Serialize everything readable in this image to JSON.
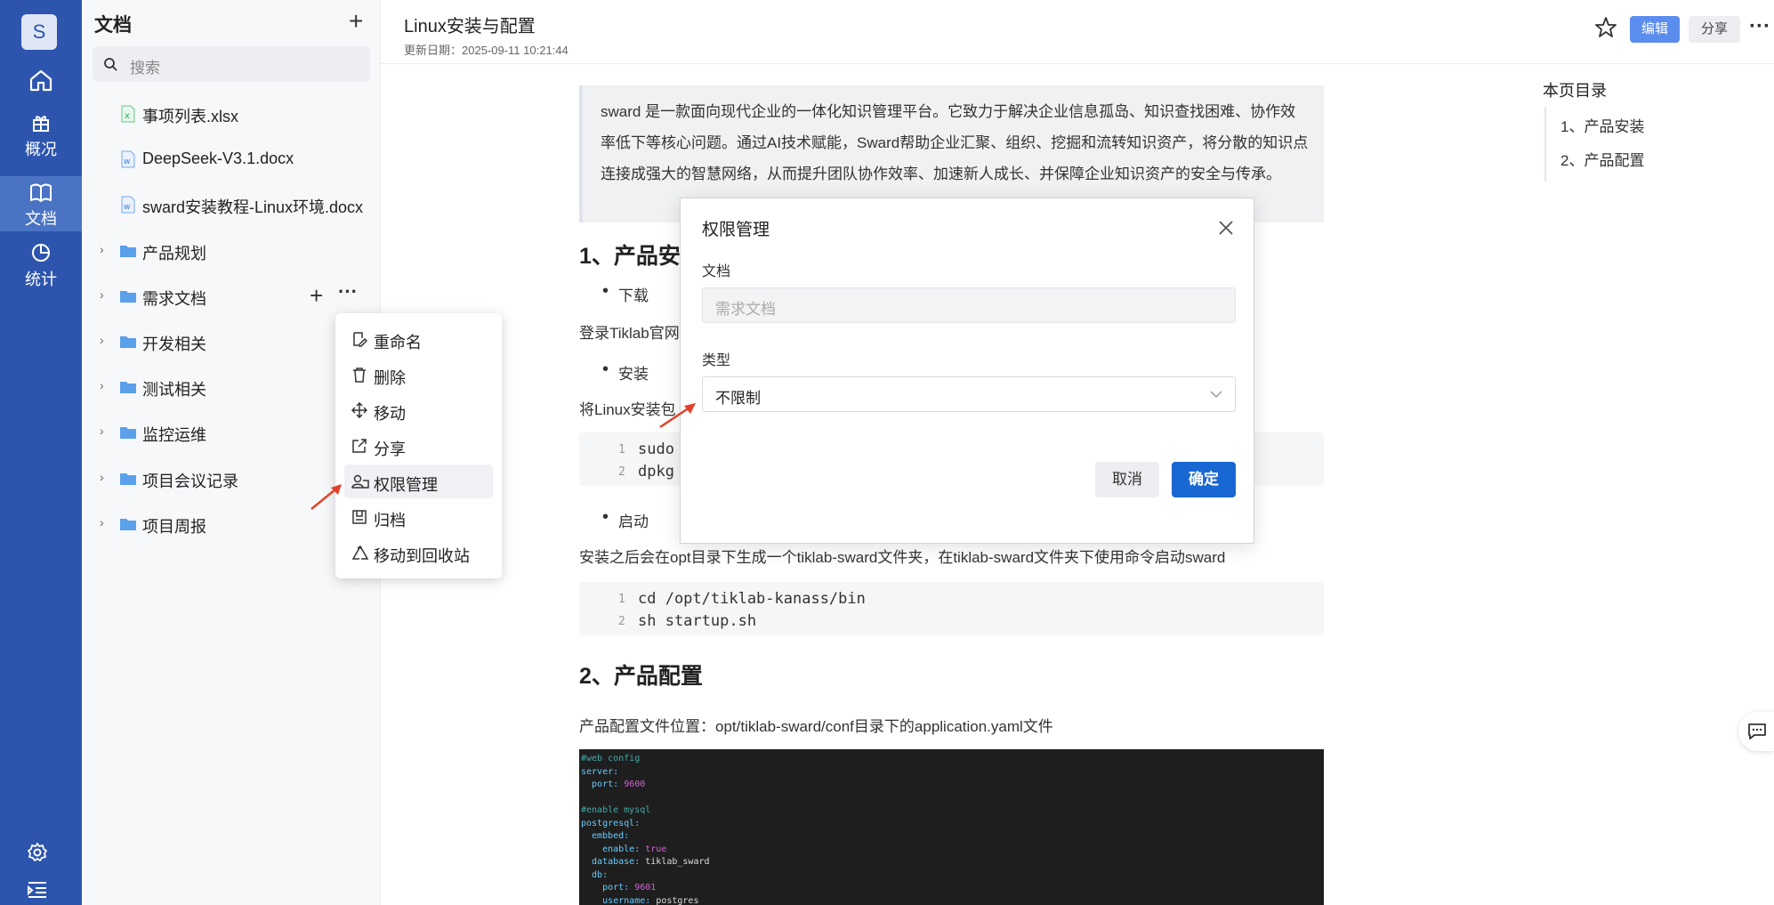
{
  "rail": {
    "avatar_letter": "S",
    "items": [
      {
        "label": ""
      },
      {
        "label": "概况"
      },
      {
        "label": "文档"
      },
      {
        "label": "统计"
      }
    ]
  },
  "sidebar": {
    "title": "文档",
    "search_placeholder": "搜索",
    "files": [
      {
        "name": "事项列表.xlsx",
        "type": "xlsx"
      },
      {
        "name": "DeepSeek-V3.1.docx",
        "type": "docx"
      },
      {
        "name": "sward安装教程-Linux环境.docx",
        "type": "docx"
      }
    ],
    "folders": [
      {
        "name": "产品规划"
      },
      {
        "name": "需求文档"
      },
      {
        "name": "开发相关"
      },
      {
        "name": "测试相关"
      },
      {
        "name": "监控运维"
      },
      {
        "name": "项目会议记录"
      },
      {
        "name": "项目周报"
      }
    ]
  },
  "context_menu": {
    "items": [
      "重命名",
      "删除",
      "移动",
      "分享",
      "权限管理",
      "归档",
      "移动到回收站"
    ],
    "highlighted": "权限管理"
  },
  "header": {
    "title": "Linux安装与配置",
    "date": "更新日期：2025-09-11 10:21:44",
    "edit_label": "编辑",
    "share_label": "分享"
  },
  "content": {
    "quote": "sward 是一款面向现代企业的一体化知识管理平台。它致力于解决企业信息孤岛、知识查找困难、协作效率低下等核心问题。通过AI技术赋能，Sward帮助企业汇聚、组织、挖掘和流转知识资产，将分散的知识点连接成强大的智慧网络，从而提升团队协作效率、加速新人成长、并保障企业知识资产的安全与传承。",
    "h1": "1、产品安",
    "bullet_download": "下载",
    "para_login": "登录Tiklab官网",
    "bullet_install": "安装",
    "para_linux": "将Linux安装包",
    "code1": [
      "sudo",
      "dpkg"
    ],
    "bullet_start": "启动",
    "para_after": "安装之后会在opt目录下生成一个tiklab-sward文件夹，在tiklab-sward文件夹下使用命令启动sward",
    "code2": [
      "cd /opt/tiklab-kanass/bin",
      "sh startup.sh"
    ],
    "h2": "2、产品配置",
    "para_config": "产品配置文件位置：opt/tiklab-sward/conf目录下的application.yaml文件"
  },
  "toc": {
    "title": "本页目录",
    "items": [
      "1、产品安装",
      "2、产品配置"
    ]
  },
  "modal": {
    "title": "权限管理",
    "doc_label": "文档",
    "doc_placeholder": "需求文档",
    "type_label": "类型",
    "type_value": "不限制",
    "cancel_label": "取消",
    "ok_label": "确定"
  }
}
